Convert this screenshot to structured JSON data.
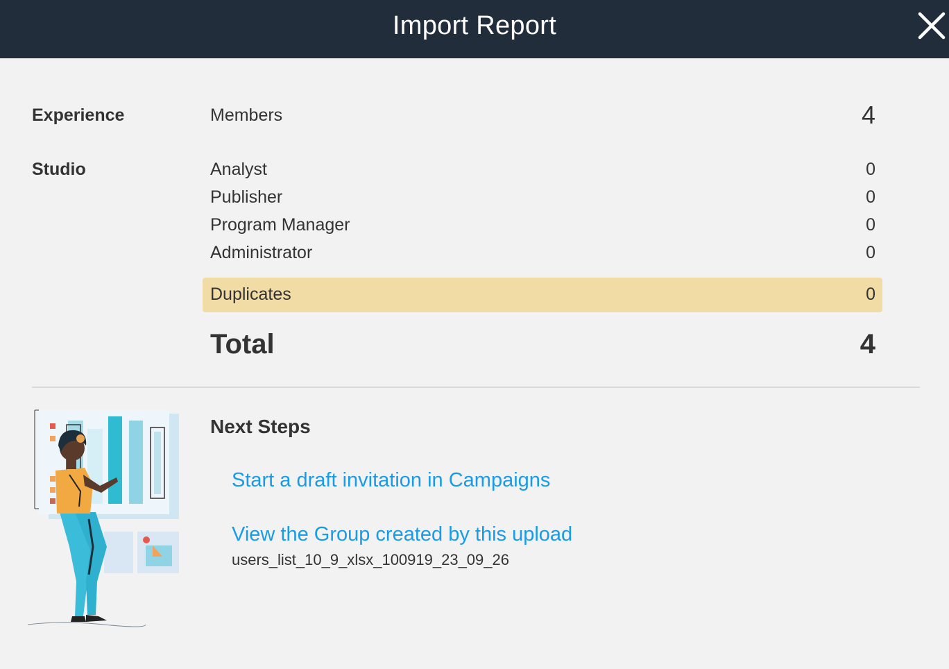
{
  "header": {
    "title": "Import Report",
    "close_icon": "close-icon"
  },
  "experience": {
    "label": "Experience",
    "rows": [
      {
        "role": "Members",
        "count": "4"
      }
    ]
  },
  "studio": {
    "label": "Studio",
    "rows": [
      {
        "role": "Analyst",
        "count": "0"
      },
      {
        "role": "Publisher",
        "count": "0"
      },
      {
        "role": "Program Manager",
        "count": "0"
      },
      {
        "role": "Administrator",
        "count": "0"
      }
    ]
  },
  "duplicates": {
    "label": "Duplicates",
    "count": "0",
    "highlight_color": "#f1dca5"
  },
  "total": {
    "label": "Total",
    "count": "4"
  },
  "next_steps": {
    "heading": "Next Steps",
    "links": [
      {
        "label": "Start a draft invitation in Campaigns"
      },
      {
        "label": "View the Group created by this upload"
      }
    ],
    "group_name": "users_list_10_9_xlsx_100919_23_09_26"
  },
  "colors": {
    "header_bg": "#222d3b",
    "link": "#1a9be6",
    "page_bg": "#f2f2f2"
  },
  "illustration": "woman-presenting-bar-chart-illustration"
}
